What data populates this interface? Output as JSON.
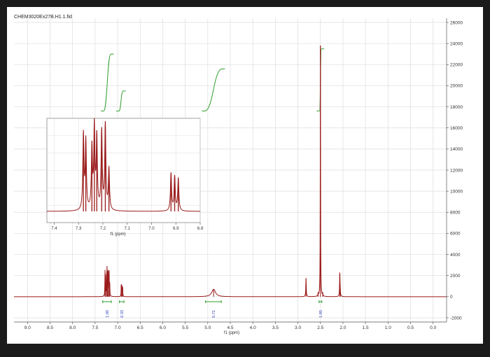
{
  "chart_data": [
    {
      "type": "line",
      "title": "CHEM3020Ex27B.H1.1.fid",
      "xlabel": "f1 (ppm)",
      "xlim": [
        9.3,
        -0.3
      ],
      "ylim": [
        -2400,
        26400
      ],
      "x_ticks": [
        "9.0",
        "8.5",
        "8.0",
        "7.5",
        "7.0",
        "6.5",
        "6.0",
        "5.5",
        "5.0",
        "4.5",
        "4.0",
        "3.5",
        "3.0",
        "2.5",
        "2.0",
        "1.5",
        "1.0",
        "0.5",
        "0.0"
      ],
      "y_ticks": [
        "-2000",
        "0",
        "2000",
        "4000",
        "6000",
        "8000",
        "10000",
        "12000",
        "14000",
        "16000",
        "18000",
        "20000",
        "22000",
        "24000",
        "26000"
      ],
      "grid": true,
      "line_color": "#9b1b1b",
      "peaks": [
        {
          "ppm": 7.28,
          "height": 2200,
          "width": 0.004
        },
        {
          "ppm": 7.27,
          "height": 2000,
          "width": 0.004
        },
        {
          "ppm": 7.245,
          "height": 1800,
          "width": 0.004
        },
        {
          "ppm": 7.235,
          "height": 2400,
          "width": 0.004
        },
        {
          "ppm": 7.225,
          "height": 2100,
          "width": 0.004
        },
        {
          "ppm": 7.205,
          "height": 2300,
          "width": 0.004
        },
        {
          "ppm": 7.19,
          "height": 2500,
          "width": 0.004
        },
        {
          "ppm": 7.175,
          "height": 1200,
          "width": 0.004
        },
        {
          "ppm": 6.92,
          "height": 1100,
          "width": 0.004
        },
        {
          "ppm": 6.905,
          "height": 1000,
          "width": 0.004
        },
        {
          "ppm": 6.89,
          "height": 950,
          "width": 0.004
        },
        {
          "ppm": 4.87,
          "height": 700,
          "width": 0.05
        },
        {
          "ppm": 2.82,
          "height": 1750,
          "width": 0.006
        },
        {
          "ppm": 2.55,
          "height": 250,
          "width": 0.006
        },
        {
          "ppm": 2.5,
          "height": 23800,
          "width": 0.004
        },
        {
          "ppm": 2.45,
          "height": 250,
          "width": 0.006
        },
        {
          "ppm": 2.07,
          "height": 2300,
          "width": 0.006
        },
        {
          "ppm": 2.06,
          "height": 300,
          "width": 0.006
        }
      ],
      "integrals": [
        {
          "from": 7.33,
          "to": 7.14,
          "label": "1.00"
        },
        {
          "from": 6.96,
          "to": 6.86,
          "label": "0.33"
        },
        {
          "from": 5.05,
          "to": 4.7,
          "label": "0.71"
        },
        {
          "from": 2.53,
          "to": 2.47,
          "label": "1.85"
        }
      ],
      "integral_curves": [
        {
          "from": 7.31,
          "to": 7.15,
          "y_start": 17600,
          "y_end": 23000
        },
        {
          "from": 6.97,
          "to": 6.88,
          "y_start": 17600,
          "y_end": 19500
        },
        {
          "from": 5.07,
          "to": 4.68,
          "y_start": 17600,
          "y_end": 21600
        },
        {
          "from": 2.52,
          "to": 2.48,
          "y_start": 17600,
          "y_end": 23500
        }
      ]
    },
    {
      "type": "line",
      "xlabel": "f1 (ppm)",
      "xlim": [
        7.43,
        6.8
      ],
      "x_ticks": [
        "7.4",
        "7.3",
        "7.2",
        "7.1",
        "7.0",
        "6.9",
        "6.8"
      ],
      "grid": true,
      "line_color": "#9b1b1b"
    }
  ]
}
